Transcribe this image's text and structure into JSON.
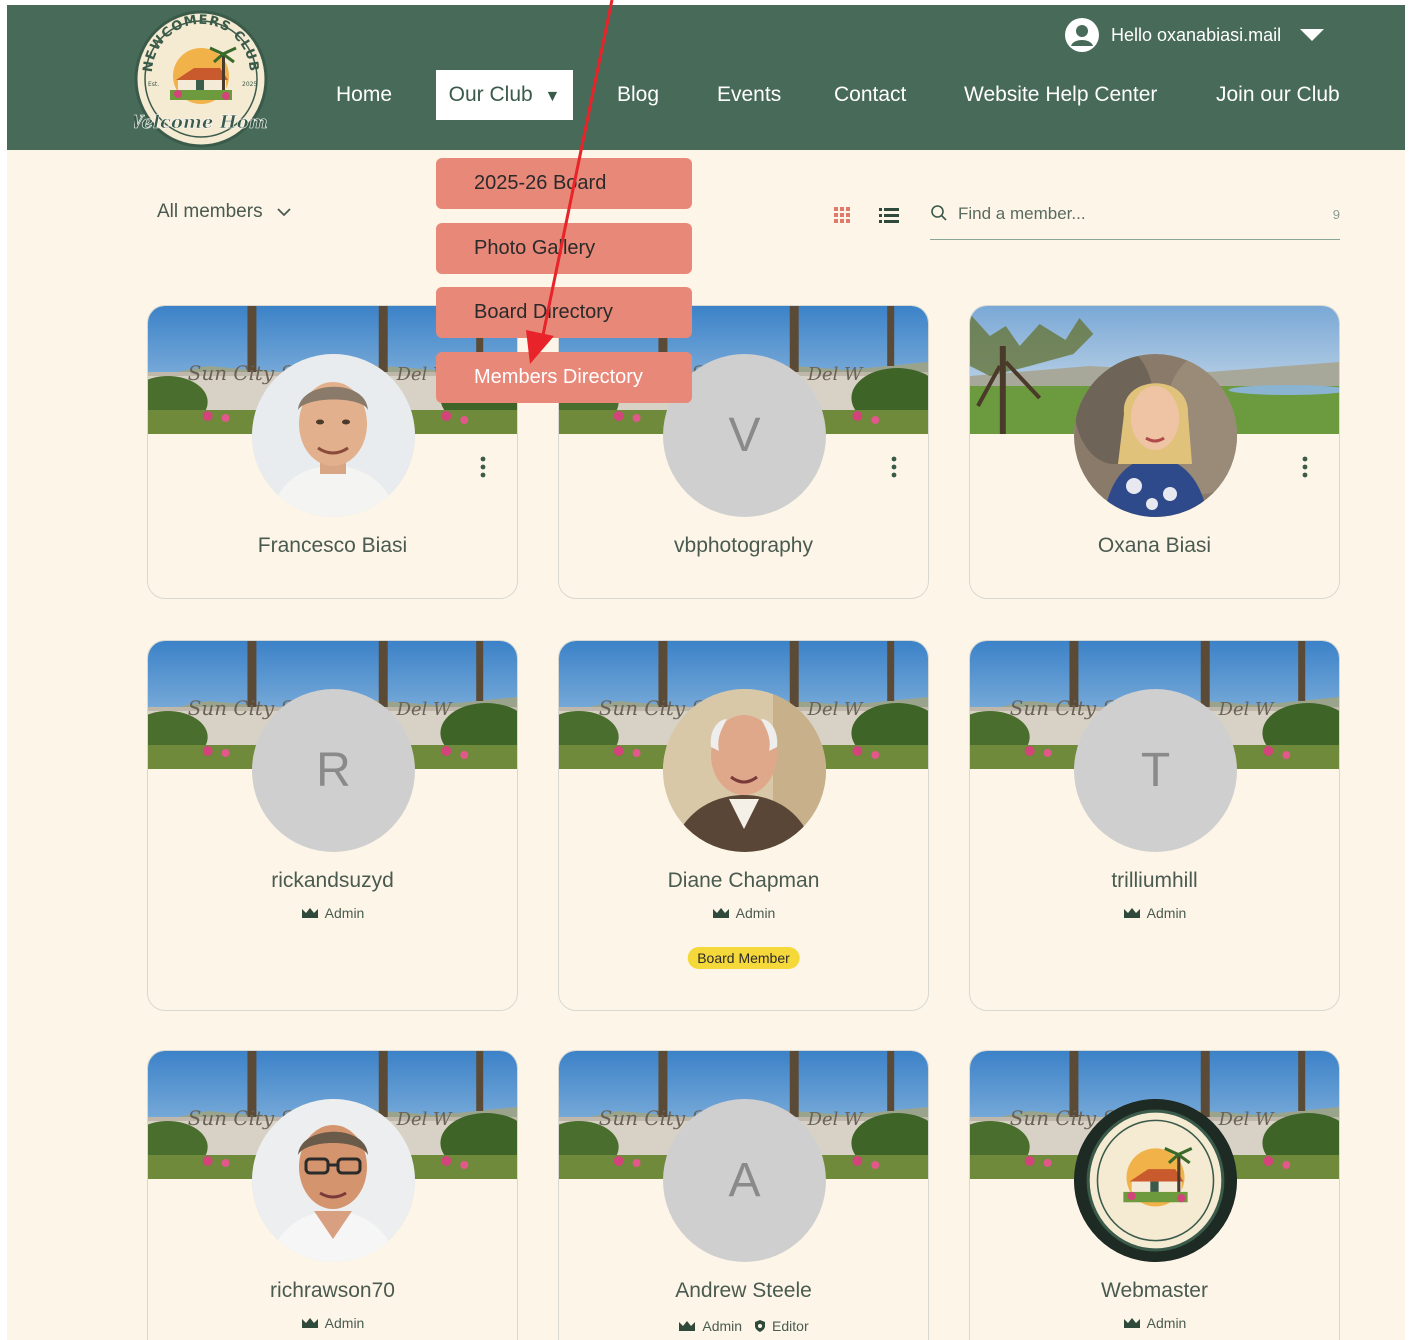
{
  "header": {
    "user_greeting": "Hello oxanabiasi.mail",
    "nav": [
      {
        "label": "Home"
      },
      {
        "label": "Our Club"
      },
      {
        "label": "Blog"
      },
      {
        "label": "Events"
      },
      {
        "label": "Contact"
      },
      {
        "label": "Website Help Center"
      },
      {
        "label": "Join our Club"
      }
    ],
    "logo": {
      "top_text": "NEWCOMERS CLUB",
      "script_text": "Welcome Home",
      "est_left": "Est.",
      "est_right": "2025"
    }
  },
  "dropdown": {
    "items": [
      {
        "label": "2025-26 Board"
      },
      {
        "label": "Photo Gallery"
      },
      {
        "label": "Board Directory"
      },
      {
        "label": "Members Directory"
      }
    ]
  },
  "toolbar": {
    "filter_label": "All members",
    "search_placeholder": "Find a member...",
    "member_count": "9"
  },
  "members": [
    {
      "name": "Francesco Biasi",
      "avatar": "photo",
      "roles": [],
      "badge": ""
    },
    {
      "name": "vbphotography",
      "avatar": "initial",
      "initial": "V",
      "roles": [],
      "badge": ""
    },
    {
      "name": "Oxana Biasi",
      "avatar": "photo",
      "roles": [],
      "badge": ""
    },
    {
      "name": "rickandsuzyd",
      "avatar": "initial",
      "initial": "R",
      "roles": [
        "Admin"
      ],
      "badge": ""
    },
    {
      "name": "Diane Chapman",
      "avatar": "photo",
      "roles": [
        "Admin"
      ],
      "badge": "Board Member"
    },
    {
      "name": "trilliumhill",
      "avatar": "initial",
      "initial": "T",
      "roles": [
        "Admin"
      ],
      "badge": ""
    },
    {
      "name": "richrawson70",
      "avatar": "photo",
      "roles": [
        "Admin"
      ],
      "badge": ""
    },
    {
      "name": "Andrew Steele",
      "avatar": "initial",
      "initial": "A",
      "roles": [
        "Admin",
        "Editor"
      ],
      "badge": ""
    },
    {
      "name": "Webmaster",
      "avatar": "logo",
      "roles": [
        "Admin"
      ],
      "badge": ""
    }
  ],
  "colors": {
    "header_bg": "#486a58",
    "page_bg": "#fdf6e8",
    "dropdown_bg": "#e88878",
    "badge_bg": "#f5d83a",
    "annotation_arrow": "#e8232a"
  }
}
